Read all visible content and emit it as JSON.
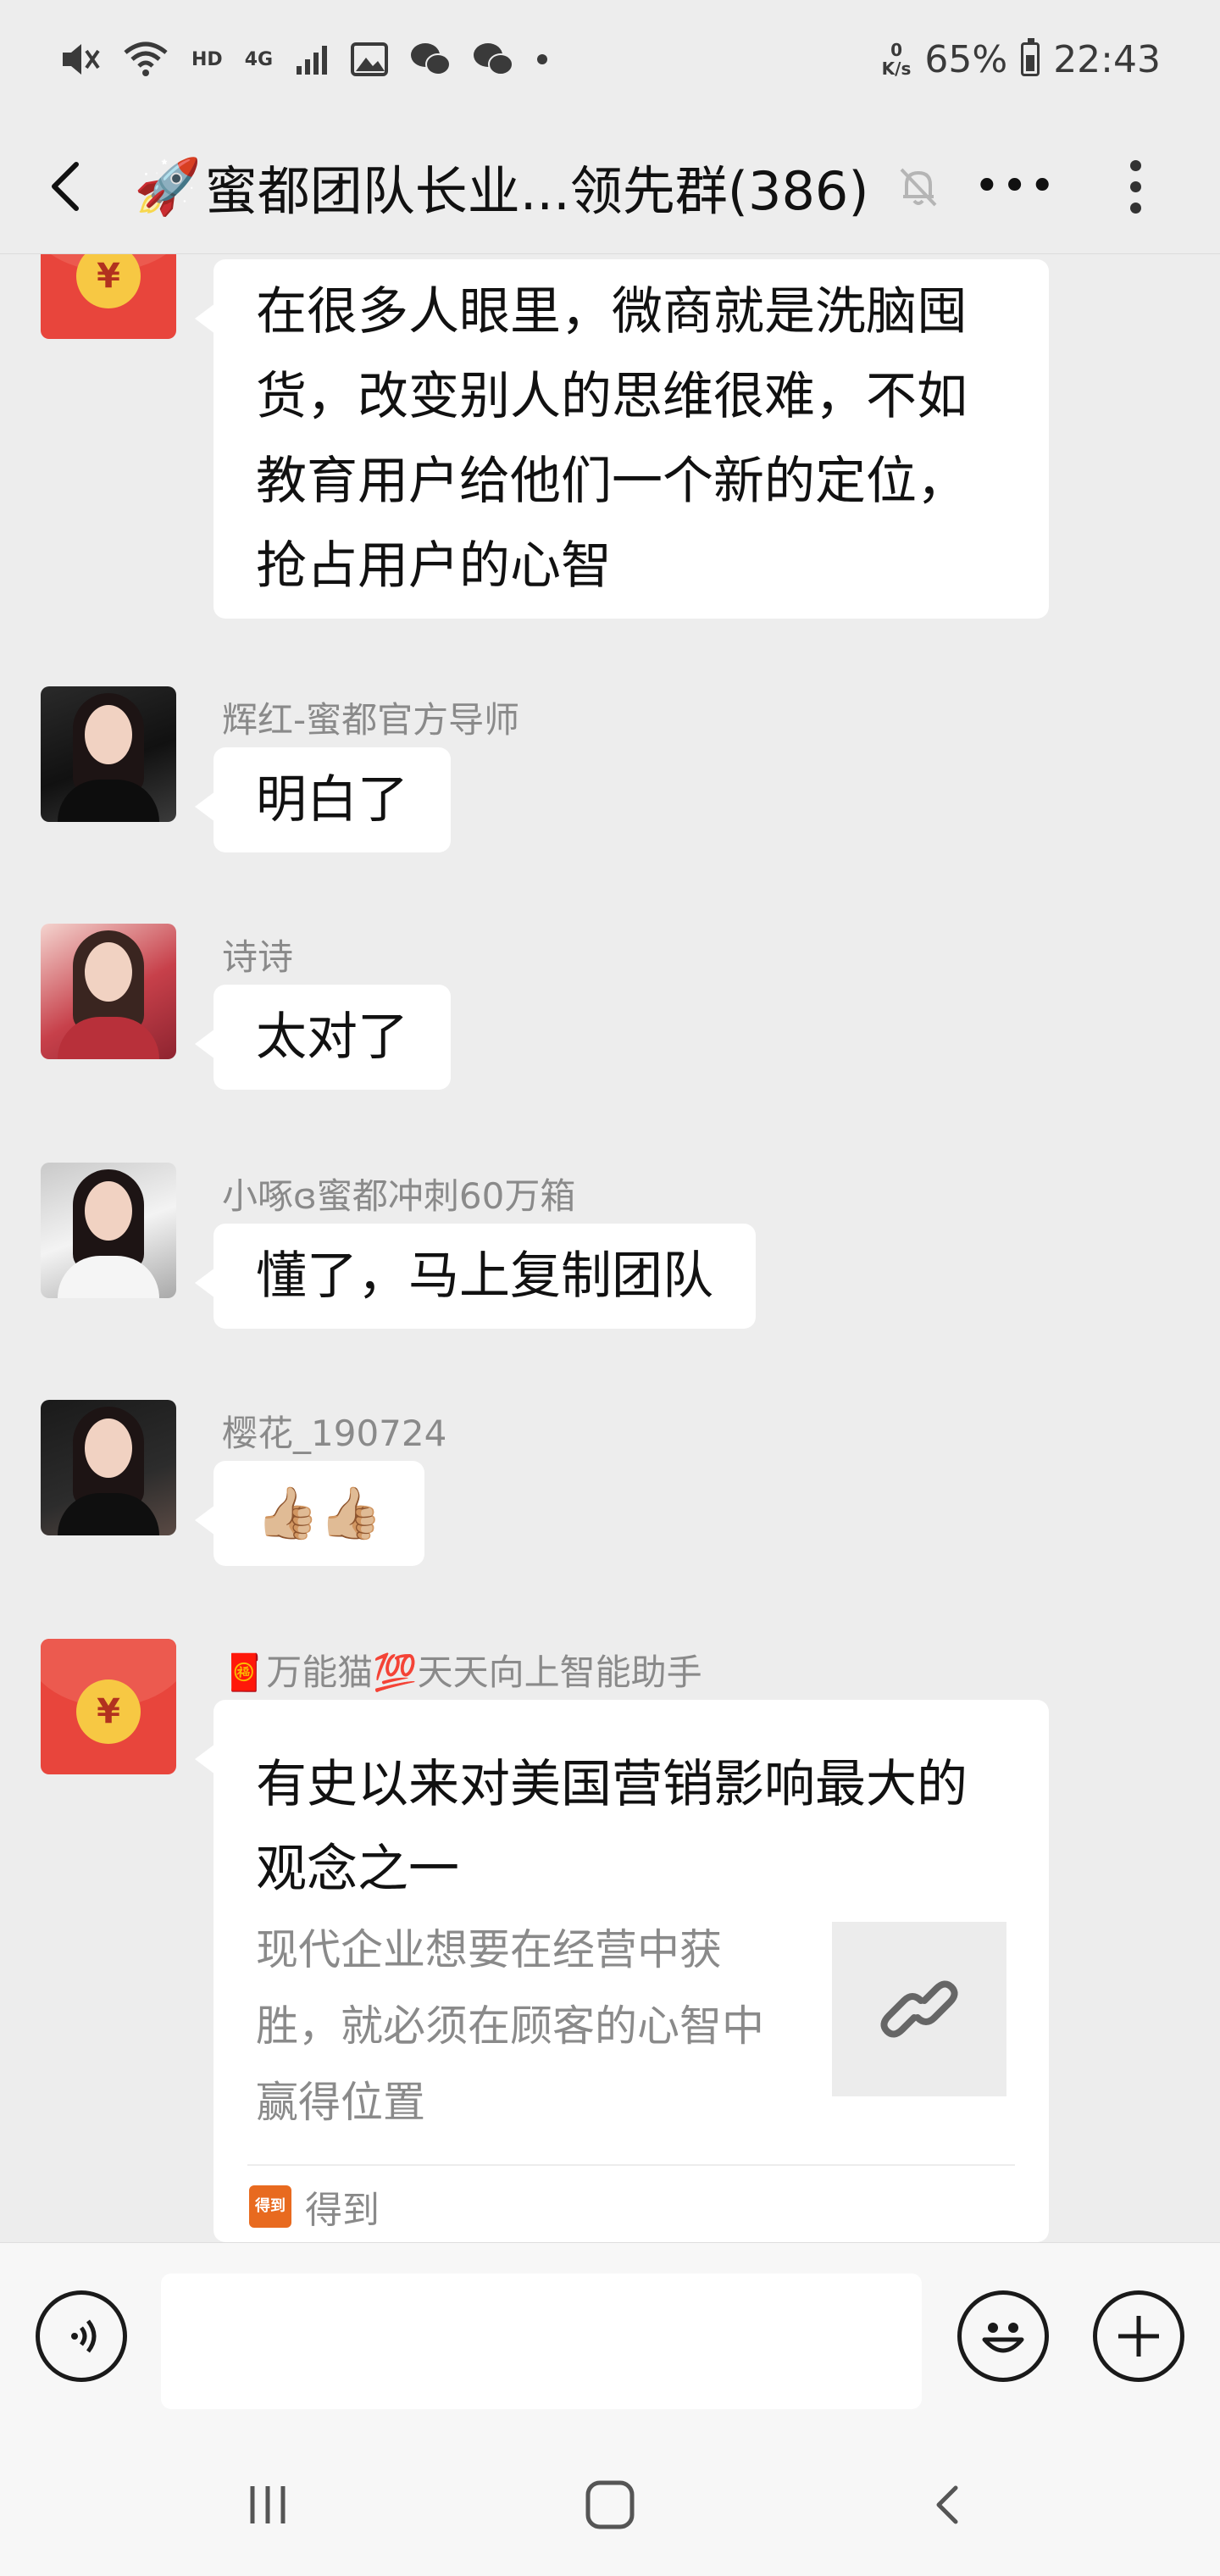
{
  "status_bar": {
    "hd_label": "HD",
    "network_label": "4G",
    "speed_value": "0",
    "speed_unit": "K/s",
    "battery": "65%",
    "time": "22:43"
  },
  "header": {
    "rocket": "🚀",
    "title": "蜜都团队长业...领先群(386)",
    "dots": "•••"
  },
  "messages": [
    {
      "text": "在很多人眼里，微商就是洗脑囤\n货，改变别人的思维很难，不如\n教育用户给他们一个新的定位，\n抢占用户的心智"
    },
    {
      "sender": "辉红-蜜都官方导师",
      "text": "明白了"
    },
    {
      "sender": "诗诗",
      "text": "太对了"
    },
    {
      "sender": "小啄ɞ蜜都冲刺60万箱",
      "text": "懂了，马上复制团队"
    },
    {
      "sender": "樱花_190724",
      "text": "👍🏼👍🏼"
    },
    {
      "sender": "🧧万能猫💯天天向上智能助手",
      "card": {
        "title": "有史以来对美国营销影响最大的观念之一",
        "description": "现代企业想要在经营中获胜，就必须在顾客的心智中赢得位置",
        "source_logo": "得到",
        "source": "得到"
      }
    }
  ],
  "input": {
    "value": "",
    "placeholder": ""
  },
  "colors": {
    "background": "#ededed",
    "bubble": "#ffffff",
    "redpacket": "#e8453c",
    "coin": "#f7c843",
    "meta_text": "#8a8a8a"
  },
  "icons": [
    "mute-icon",
    "wifi-icon",
    "signal-icon",
    "gallery-icon",
    "wechat-icon",
    "back-icon",
    "bell-off-icon",
    "more-vertical-icon",
    "voice-icon",
    "emoji-icon",
    "plus-icon",
    "link-icon",
    "recent-apps-icon",
    "home-icon",
    "nav-back-icon"
  ]
}
